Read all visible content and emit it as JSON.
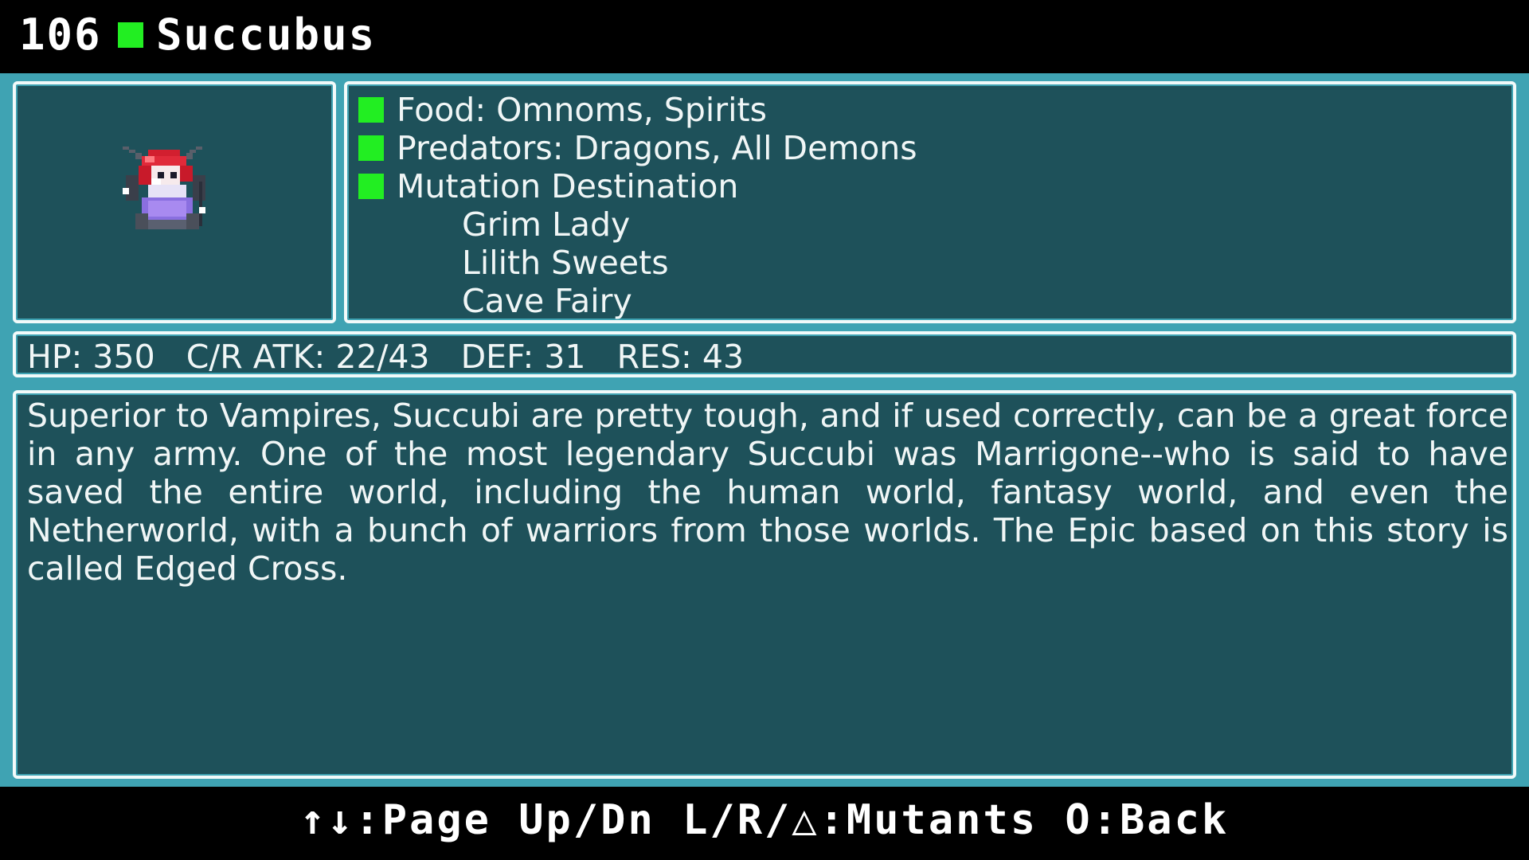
{
  "header": {
    "number": "106",
    "name": "Succubus",
    "accent": "#22ee22"
  },
  "info": {
    "food": "Food: Omnoms, Spirits",
    "predators": "Predators: Dragons, All Demons",
    "mutation_heading": "Mutation Destination",
    "mutations": [
      "Grim Lady",
      "Lilith Sweets",
      "Cave Fairy"
    ]
  },
  "stats": {
    "line": "HP: 350   C/R ATK: 22/43   DEF: 31   RES: 43"
  },
  "description": "Superior to Vampires, Succubi are pretty tough, and if used correctly, can be a great force in any army. One of the most legendary Succubi was Marrigone--who is said to have saved the entire world, including the human world, fantasy world, and even the Netherworld, with a bunch of warriors from those worlds. The Epic based on this story is called Edged Cross.",
  "footer": {
    "controls": "↑↓:Page Up/Dn L/R/△:Mutants O:Back"
  },
  "colors": {
    "panel": "#1e515a",
    "frame": "#3fa3b3",
    "border": "#f2fafa"
  },
  "icons": {
    "portrait": "succubus-sprite"
  }
}
